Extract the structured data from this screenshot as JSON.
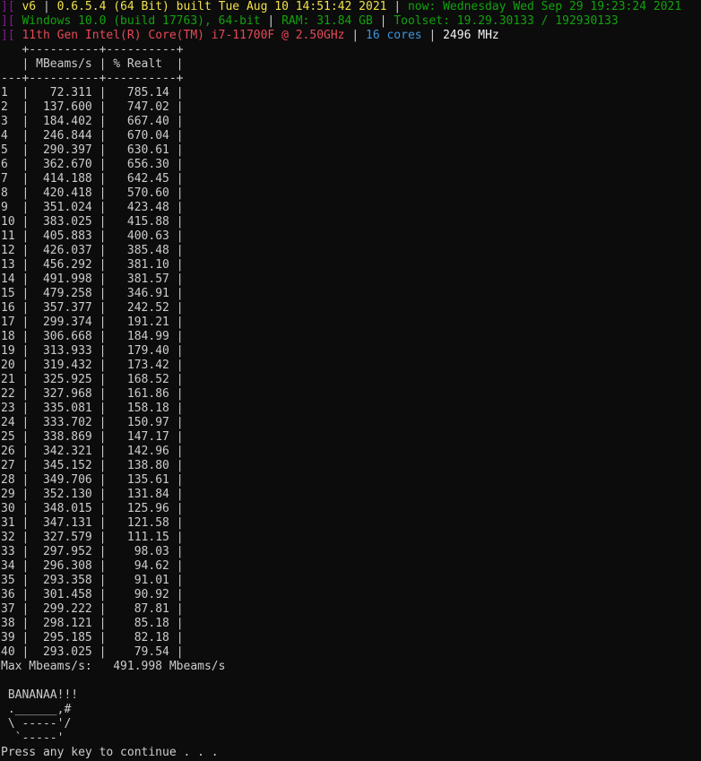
{
  "header": {
    "bracket": "][",
    "line1": {
      "version": "v6",
      "sep": "|",
      "build": "0.6.5.4 (64 Bit) built Tue Aug 10 14:51:42 2021",
      "now": "now: Wednesday Wed Sep 29 19:23:24 2021"
    },
    "line2": {
      "os": "Windows 10.0 (build 17763), 64-bit",
      "sep": "|",
      "ram": "RAM: 31.84 GB",
      "toolset": "Toolset: 19.29.30133 / 192930133"
    },
    "line3": {
      "cpu": "11th Gen Intel(R) Core(TM) i7-11700F @ 2.50GHz",
      "sep": "|",
      "cores": "16 cores",
      "mhz": "2496 MHz"
    }
  },
  "table": {
    "top_border": "   +----------+----------+",
    "header_row": "   | MBeams/s | % Realt  |",
    "header_border": "---+----------+----------+",
    "rows": [
      {
        "idx": "1",
        "mbeams": "72.311",
        "realt": "785.14"
      },
      {
        "idx": "2",
        "mbeams": "137.600",
        "realt": "747.02"
      },
      {
        "idx": "3",
        "mbeams": "184.402",
        "realt": "667.40"
      },
      {
        "idx": "4",
        "mbeams": "246.844",
        "realt": "670.04"
      },
      {
        "idx": "5",
        "mbeams": "290.397",
        "realt": "630.61"
      },
      {
        "idx": "6",
        "mbeams": "362.670",
        "realt": "656.30"
      },
      {
        "idx": "7",
        "mbeams": "414.188",
        "realt": "642.45"
      },
      {
        "idx": "8",
        "mbeams": "420.418",
        "realt": "570.60"
      },
      {
        "idx": "9",
        "mbeams": "351.024",
        "realt": "423.48"
      },
      {
        "idx": "10",
        "mbeams": "383.025",
        "realt": "415.88"
      },
      {
        "idx": "11",
        "mbeams": "405.883",
        "realt": "400.63"
      },
      {
        "idx": "12",
        "mbeams": "426.037",
        "realt": "385.48"
      },
      {
        "idx": "13",
        "mbeams": "456.292",
        "realt": "381.10"
      },
      {
        "idx": "14",
        "mbeams": "491.998",
        "realt": "381.57"
      },
      {
        "idx": "15",
        "mbeams": "479.258",
        "realt": "346.91"
      },
      {
        "idx": "16",
        "mbeams": "357.377",
        "realt": "242.52"
      },
      {
        "idx": "17",
        "mbeams": "299.374",
        "realt": "191.21"
      },
      {
        "idx": "18",
        "mbeams": "306.668",
        "realt": "184.99"
      },
      {
        "idx": "19",
        "mbeams": "313.933",
        "realt": "179.40"
      },
      {
        "idx": "20",
        "mbeams": "319.432",
        "realt": "173.42"
      },
      {
        "idx": "21",
        "mbeams": "325.925",
        "realt": "168.52"
      },
      {
        "idx": "22",
        "mbeams": "327.968",
        "realt": "161.86"
      },
      {
        "idx": "23",
        "mbeams": "335.081",
        "realt": "158.18"
      },
      {
        "idx": "24",
        "mbeams": "333.702",
        "realt": "150.97"
      },
      {
        "idx": "25",
        "mbeams": "338.869",
        "realt": "147.17"
      },
      {
        "idx": "26",
        "mbeams": "342.321",
        "realt": "142.96"
      },
      {
        "idx": "27",
        "mbeams": "345.152",
        "realt": "138.80"
      },
      {
        "idx": "28",
        "mbeams": "349.706",
        "realt": "135.61"
      },
      {
        "idx": "29",
        "mbeams": "352.130",
        "realt": "131.84"
      },
      {
        "idx": "30",
        "mbeams": "348.015",
        "realt": "125.96"
      },
      {
        "idx": "31",
        "mbeams": "347.131",
        "realt": "121.58"
      },
      {
        "idx": "32",
        "mbeams": "327.579",
        "realt": "111.15"
      },
      {
        "idx": "33",
        "mbeams": "297.952",
        "realt": "98.03"
      },
      {
        "idx": "34",
        "mbeams": "296.308",
        "realt": "94.62"
      },
      {
        "idx": "35",
        "mbeams": "293.358",
        "realt": "91.01"
      },
      {
        "idx": "36",
        "mbeams": "301.458",
        "realt": "90.92"
      },
      {
        "idx": "37",
        "mbeams": "299.222",
        "realt": "87.81"
      },
      {
        "idx": "38",
        "mbeams": "298.121",
        "realt": "85.18"
      },
      {
        "idx": "39",
        "mbeams": "295.185",
        "realt": "82.18"
      },
      {
        "idx": "40",
        "mbeams": "293.025",
        "realt": "79.54"
      }
    ]
  },
  "footer": {
    "max_line": "Max Mbeams/s:   491.998 Mbeams/s",
    "blank": "",
    "banana_title": " BANANAA!!!",
    "art1": " .______,#",
    "art2": " \\ -----'/",
    "art3": "  `-----'",
    "prompt": "Press any key to continue . . ."
  },
  "colors": {
    "background": "#0c0c0c",
    "text": "#cccccc",
    "bracket": "#881798",
    "version": "#f1e14a",
    "green": "#13a10e",
    "cpu": "#e74856",
    "cores": "#3a96dd"
  }
}
